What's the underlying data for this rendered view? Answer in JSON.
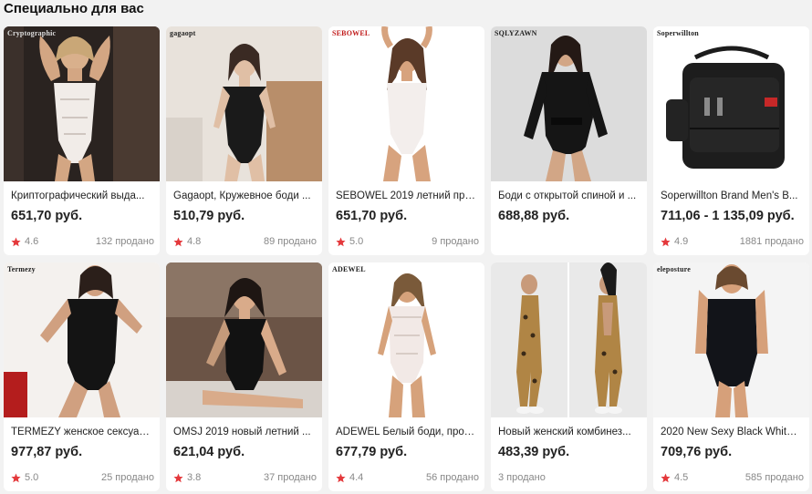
{
  "section_title": "Специально для вас",
  "colors": {
    "star": "#e4393c",
    "price": "#222222",
    "meta": "#888888"
  },
  "products": [
    {
      "brand_mark": "Cryptographic",
      "title": "Криптографический выда...",
      "price": "651,70 руб.",
      "rating": "4.6",
      "sold": "132 продано",
      "image": "white-lace-bodysuit-photo"
    },
    {
      "brand_mark": "gagaopt",
      "title": "Gagaopt, Кружевное боди ...",
      "price": "510,79 руб.",
      "rating": "4.8",
      "sold": "89 продано",
      "image": "black-lace-bodysuit-photo"
    },
    {
      "brand_mark": "SEBOWEL",
      "title": "SEBOWEL 2019 летний про...",
      "price": "651,70 руб.",
      "rating": "5.0",
      "sold": "9 продано",
      "image": "white-bodysuit-photo"
    },
    {
      "brand_mark": "SQLYZAWN",
      "title": "Боди с открытой спиной и ...",
      "price": "688,88 руб.",
      "rating": "",
      "sold": "",
      "image": "black-lace-longsleeve-bodysuit-photo"
    },
    {
      "brand_mark": "Soperwillton",
      "title": "Soperwillton Brand Men's B...",
      "price": "711,06 - 1 135,09 руб.",
      "rating": "4.9",
      "sold": "1881 продано",
      "image": "black-shoulder-bag-photo"
    },
    {
      "brand_mark": "Termezy",
      "title": "TERMEZY женское сексуаль...",
      "price": "977,87 руб.",
      "rating": "5.0",
      "sold": "25 продано",
      "image": "black-lace-bodysuit-photo"
    },
    {
      "brand_mark": "",
      "title": "OMSJ 2019 новый летний ...",
      "price": "621,04 руб.",
      "rating": "3.8",
      "sold": "37 продано",
      "image": "black-corset-bodysuit-photo"
    },
    {
      "brand_mark": "ADEWEL",
      "title": "ADEWEL Белый боди, проз...",
      "price": "677,79 руб.",
      "rating": "4.4",
      "sold": "56 продано",
      "image": "white-sheer-bodysuit-photo"
    },
    {
      "brand_mark": "",
      "title": "Новый женский комбинез...",
      "price": "483,39 руб.",
      "rating": "",
      "sold": "3 продано",
      "image": "leopard-jumpsuit-photo"
    },
    {
      "brand_mark": "eleposture",
      "title": "2020 New Sexy Black White ...",
      "price": "709,76 руб.",
      "rating": "4.5",
      "sold": "585 продано",
      "image": "black-bodysuit-photo"
    }
  ]
}
